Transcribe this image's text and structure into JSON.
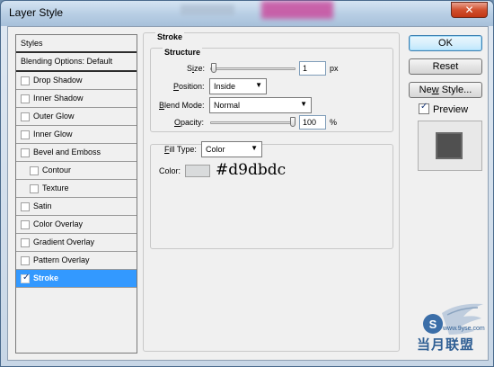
{
  "window": {
    "title": "Layer Style",
    "close_label": "✕"
  },
  "sidebar": {
    "header": "Styles",
    "blending_options": "Blending Options: Default",
    "items": [
      {
        "label": "Drop Shadow",
        "checked": false
      },
      {
        "label": "Inner Shadow",
        "checked": false
      },
      {
        "label": "Outer Glow",
        "checked": false
      },
      {
        "label": "Inner Glow",
        "checked": false
      },
      {
        "label": "Bevel and Emboss",
        "checked": false
      },
      {
        "label": "Contour",
        "checked": false
      },
      {
        "label": "Texture",
        "checked": false
      },
      {
        "label": "Satin",
        "checked": false
      },
      {
        "label": "Color Overlay",
        "checked": false
      },
      {
        "label": "Gradient Overlay",
        "checked": false
      },
      {
        "label": "Pattern Overlay",
        "checked": false
      },
      {
        "label": "Stroke",
        "checked": true
      }
    ]
  },
  "stroke": {
    "section_title": "Stroke",
    "structure_title": "Structure",
    "size_label": "Size:",
    "size_value": "1",
    "size_unit": "px",
    "size_slider_level": 0.01,
    "position_label": "Position:",
    "position_value": "Inside",
    "blend_mode_label": "Blend Mode:",
    "blend_mode_value": "Normal",
    "opacity_label": "Opacity:",
    "opacity_value": "100",
    "opacity_unit": "%",
    "opacity_slider_level": 1.0,
    "fill_type_label": "Fill Type:",
    "fill_type_value": "Color",
    "color_label": "Color:",
    "color_hex": "#d9dbdc"
  },
  "actions": {
    "ok": "OK",
    "reset": "Reset",
    "new_style": "New Style...",
    "preview_label": "Preview",
    "preview_checked": true
  },
  "watermark": {
    "text": "当月联盟",
    "sub": "www.9yse.com"
  },
  "colors": {
    "selection": "#3399ff",
    "stroke_color": "#d9dbdc",
    "preview_swatch": "#505050"
  }
}
